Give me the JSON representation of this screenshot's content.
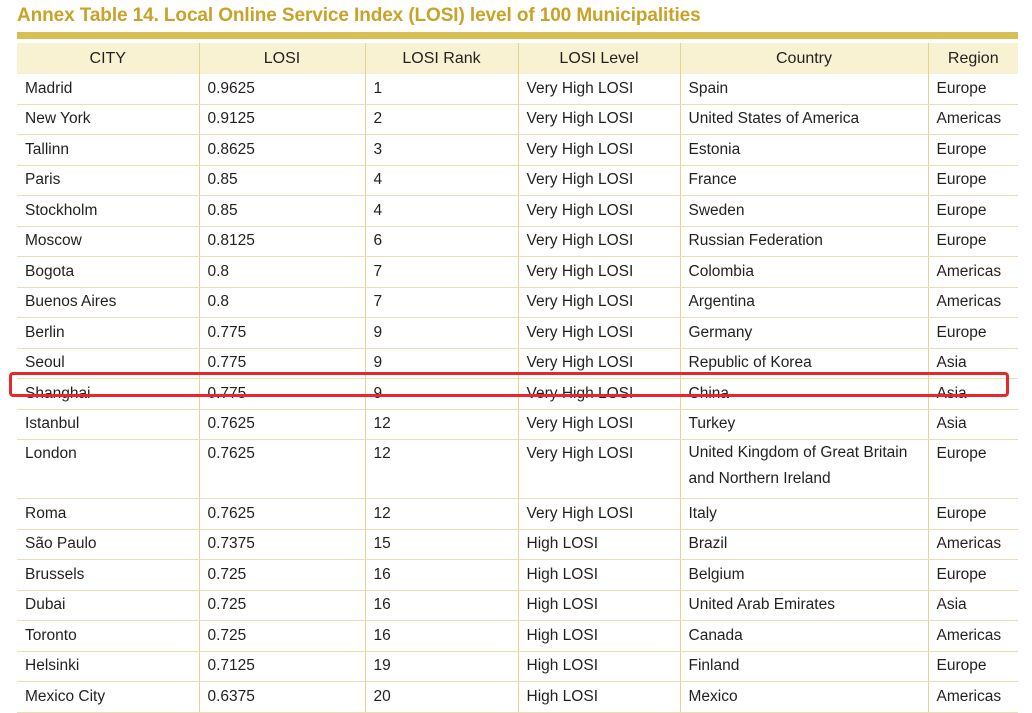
{
  "title": "Annex Table 14. Local Online Service Index (LOSI) level of 100 Municipalities",
  "columns": [
    "CITY",
    "LOSI",
    "LOSI Rank",
    "LOSI Level",
    "Country",
    "Region"
  ],
  "rows": [
    [
      "Madrid",
      "0.9625",
      "1",
      "Very High LOSI",
      "Spain",
      "Europe"
    ],
    [
      "New York",
      "0.9125",
      "2",
      "Very High LOSI",
      "United States of America",
      "Americas"
    ],
    [
      "Tallinn",
      "0.8625",
      "3",
      "Very High LOSI",
      "Estonia",
      "Europe"
    ],
    [
      "Paris",
      "0.85",
      "4",
      "Very High LOSI",
      "France",
      "Europe"
    ],
    [
      "Stockholm",
      "0.85",
      "4",
      "Very High LOSI",
      "Sweden",
      "Europe"
    ],
    [
      "Moscow",
      "0.8125",
      "6",
      "Very High LOSI",
      "Russian Federation",
      "Europe"
    ],
    [
      "Bogota",
      "0.8",
      "7",
      "Very High LOSI",
      "Colombia",
      "Americas"
    ],
    [
      "Buenos Aires",
      "0.8",
      "7",
      "Very High LOSI",
      "Argentina",
      "Americas"
    ],
    [
      "Berlin",
      "0.775",
      "9",
      "Very High LOSI",
      "Germany",
      "Europe"
    ],
    [
      "Seoul",
      "0.775",
      "9",
      "Very High LOSI",
      "Republic of Korea",
      "Asia"
    ],
    [
      "Shanghai",
      "0.775",
      "9",
      "Very High LOSI",
      "China",
      "Asia"
    ],
    [
      "Istanbul",
      "0.7625",
      "12",
      "Very High LOSI",
      "Turkey",
      "Asia"
    ],
    [
      "London",
      "0.7625",
      "12",
      "Very High LOSI",
      "United Kingdom of Great Britain and Northern Ireland",
      "Europe"
    ],
    [
      "Roma",
      "0.7625",
      "12",
      "Very High LOSI",
      "Italy",
      "Europe"
    ],
    [
      "São Paulo",
      "0.7375",
      "15",
      "High LOSI",
      "Brazil",
      "Americas"
    ],
    [
      "Brussels",
      "0.725",
      "16",
      "High LOSI",
      "Belgium",
      "Europe"
    ],
    [
      "Dubai",
      "0.725",
      "16",
      "High LOSI",
      "United Arab Emirates",
      "Asia"
    ],
    [
      "Toronto",
      "0.725",
      "16",
      "High LOSI",
      "Canada",
      "Americas"
    ],
    [
      "Helsinki",
      "0.7125",
      "19",
      "High LOSI",
      "Finland",
      "Europe"
    ],
    [
      "Mexico City",
      "0.6375",
      "20",
      "High LOSI",
      "Mexico",
      "Americas"
    ]
  ],
  "highlighted_city": "Shanghai",
  "colors": {
    "title": "#c9a227",
    "rule": "#d9bd55",
    "header_bg": "#f8f2d3",
    "highlight": "#e8272a"
  }
}
